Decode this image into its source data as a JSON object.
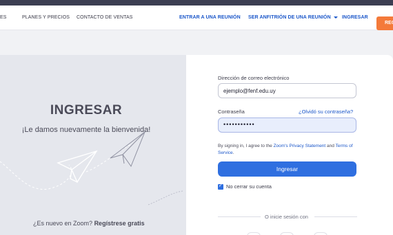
{
  "nav": {
    "left_items": [
      "ES",
      "PLANES Y PRECIOS",
      "CONTACTO DE VENTAS"
    ],
    "join_meeting": "ENTRAR A UNA REUNIÓN",
    "host_meeting": "SER ANFITRIÓN DE UNA REUNIÓN",
    "sign_in": "INGRESAR",
    "signup_partial": "REG"
  },
  "left_panel": {
    "title": "INGRESAR",
    "welcome": "¡Le damos nuevamente la bienvenida!",
    "new_text": "¿Es nuevo en Zoom?",
    "register_link": "Regístrese gratis"
  },
  "form": {
    "email_label": "Dirección de correo electrónico",
    "email_value": "ejemplo@fenf.edu.uy",
    "password_label": "Contraseña",
    "forgot_link": "¿Olvidó su contraseña?",
    "password_value": "•••••••••••",
    "terms_prefix": "By signing in, I agree to the ",
    "privacy_link": "Zoom's Privacy Statement",
    "terms_and": " and ",
    "terms_link": "Terms of Service",
    "terms_suffix": ".",
    "signin_button": "Ingresar",
    "keep_signed_in": "No cerrar su cuenta",
    "keep_signed_in_checked": true,
    "or_sign_in_with": "O inicie sesión con"
  },
  "colors": {
    "accent_blue": "#2f6fe0",
    "link_blue": "#1a56c9",
    "signup_orange": "#f47a3a",
    "left_panel_bg": "#e5e7ed"
  }
}
